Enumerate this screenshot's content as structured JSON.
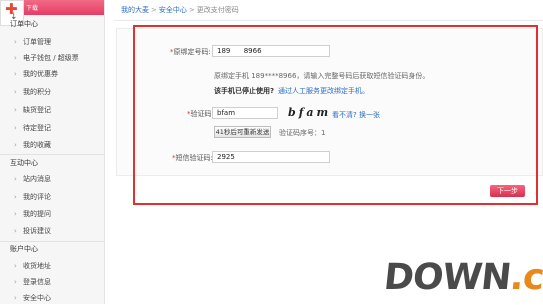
{
  "sidebar": {
    "logo_text": "下载",
    "sections": [
      {
        "title": "订单中心",
        "items": [
          {
            "label": "订单管理"
          },
          {
            "label": "电子钱包 / 超级票"
          },
          {
            "label": "我的优惠券"
          },
          {
            "label": "我的积分"
          },
          {
            "label": "缺货登记"
          },
          {
            "label": "待定登记"
          },
          {
            "label": "我的收藏"
          }
        ]
      },
      {
        "title": "互动中心",
        "items": [
          {
            "label": "站内消息"
          },
          {
            "label": "我的评论"
          },
          {
            "label": "我的提问"
          },
          {
            "label": "投诉建议"
          }
        ]
      },
      {
        "title": "账户中心",
        "items": [
          {
            "label": "收货地址"
          },
          {
            "label": "登录信息"
          },
          {
            "label": "安全中心"
          }
        ]
      }
    ]
  },
  "breadcrumb": [
    "我的大麦",
    "安全中心",
    "更改支付密码"
  ],
  "form": {
    "phone_label": "原绑定号码:",
    "phone_value": "189      8966",
    "phone_hint": "原绑定手机 189****8966，请输入完整号码后获取短信验证码身份。",
    "stopped_question": "该手机已停止使用?",
    "manual_link": "通过人工服务更改绑定手机。",
    "code_label": "验证码:",
    "code_value": "bfam",
    "captcha_text": "bfam",
    "refresh_link": "看不清? 换一张",
    "resend_button": "41秒后可重新发送",
    "serial_text": "验证码序号：1",
    "sms_label": "短信验证码:",
    "sms_value": "2925",
    "next_button": "下一步"
  },
  "watermark": {
    "part1": "DOWN",
    "part2": ".cc"
  },
  "colors": {
    "brand_pink": "#e63c63",
    "link_blue": "#2a6dc9",
    "frame_red": "#e03030",
    "watermark_orange": "#e8891c"
  }
}
